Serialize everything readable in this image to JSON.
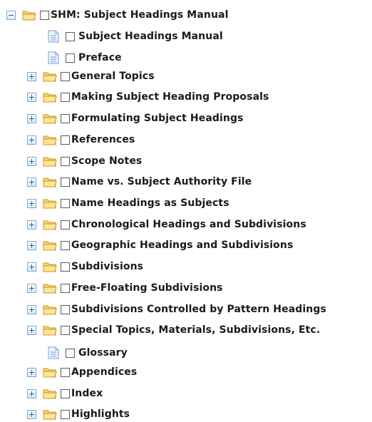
{
  "tree": {
    "root": {
      "label": "SHM: Subject Headings Manual"
    },
    "docs": {
      "subject_headings_manual": "Subject Headings Manual",
      "preface": "Preface",
      "glossary": "Glossary"
    },
    "folders": {
      "general_topics": "General Topics",
      "making_proposals": "Making Subject Heading Proposals",
      "formulating": "Formulating Subject Headings",
      "references": "References",
      "scope_notes": "Scope Notes",
      "name_vs_subject": "Name vs. Subject Authority File",
      "name_headings": "Name Headings as Subjects",
      "chronological": "Chronological Headings and Subdivisions",
      "geographic": "Geographic Headings and Subdivisions",
      "subdivisions": "Subdivisions",
      "free_floating": "Free-Floating Subdivisions",
      "pattern_headings": "Subdivisions Controlled by Pattern Headings",
      "special_topics": "Special Topics, Materials, Subdivisions, Etc.",
      "appendices": "Appendices",
      "index": "Index",
      "highlights": "Highlights"
    }
  },
  "icons": {
    "expand": "plus-icon",
    "collapse": "minus-icon",
    "folder": "folder-icon",
    "document": "document-icon"
  },
  "colors": {
    "folder_fill": "#f7d46b",
    "folder_edge": "#c9982a",
    "toggle_border": "#7fa6cf",
    "doc_blue": "#6f9fd8"
  }
}
